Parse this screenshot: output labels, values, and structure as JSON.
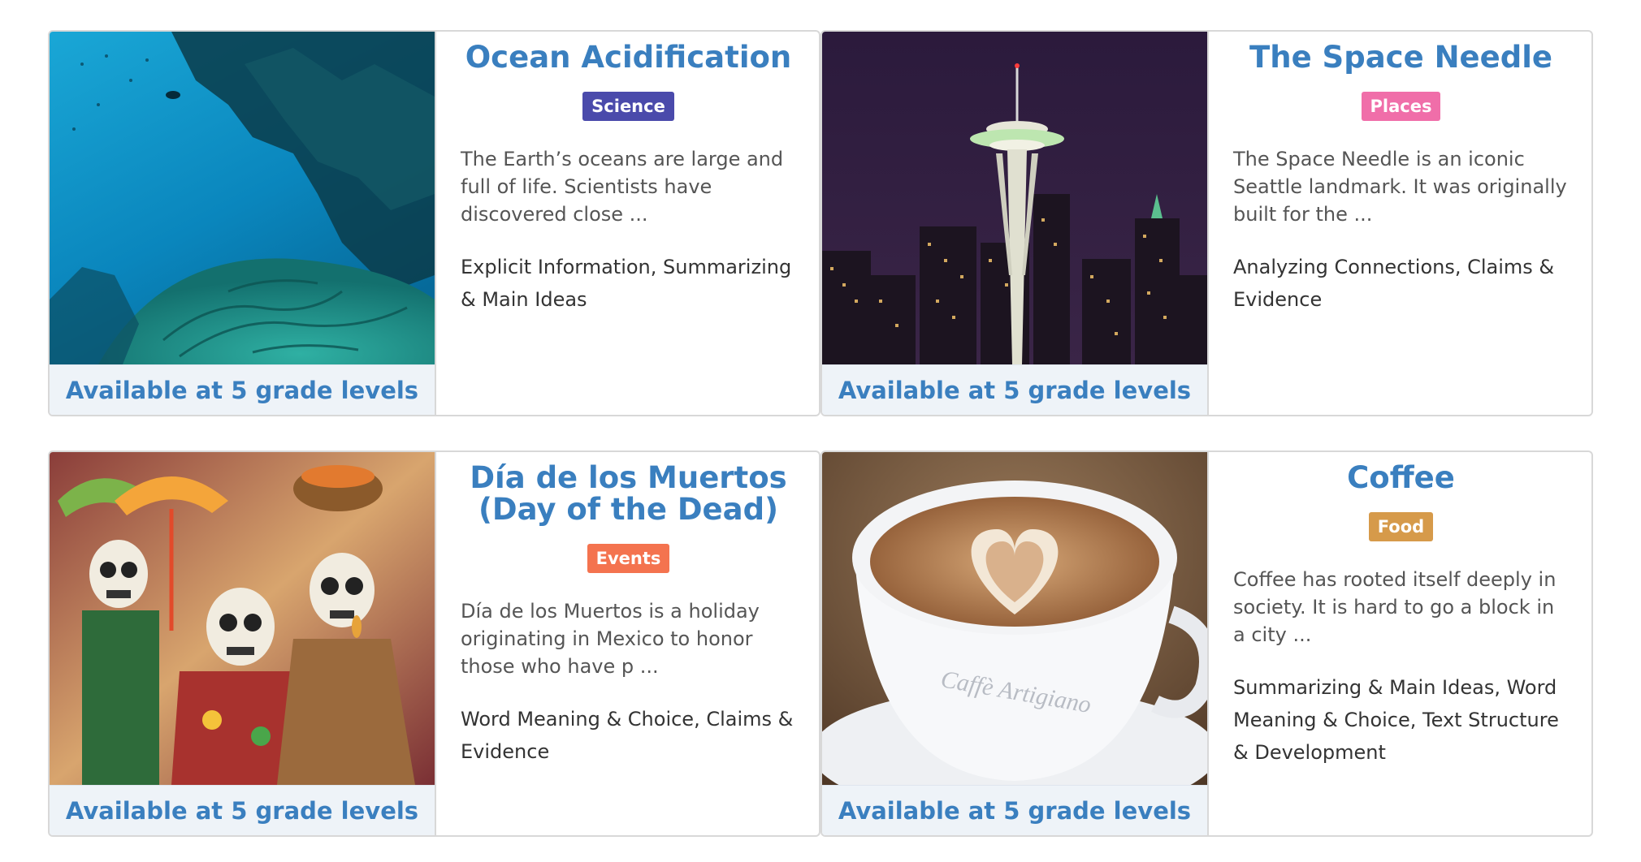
{
  "cards": [
    {
      "title": "Ocean Acidification",
      "tag": "Science",
      "tag_color": "#4a4aab",
      "description": "The Earth’s oceans are large and full of life. Scientists have discovered close ...",
      "skills": "Explicit Information, Summarizing & Main Ideas",
      "availability": "Available at 5 grade levels",
      "image": "coral-reef-photo"
    },
    {
      "title": "The Space Needle",
      "tag": "Places",
      "tag_color": "#f06ea9",
      "description": "The Space Needle is an iconic Seattle landmark. It was originally built for the ...",
      "skills": "Analyzing Connections, Claims & Evidence",
      "availability": "Available at 5 grade levels",
      "image": "seattle-skyline-photo"
    },
    {
      "title": "Día de los Muertos (Day of the Dead)",
      "tag": "Events",
      "tag_color": "#f4734f",
      "description": "Día de los Muertos is a holiday originating in Mexico to honor those who have p ...",
      "skills": "Word Meaning & Choice, Claims & Evidence",
      "availability": "Available at 5 grade levels",
      "image": "skeleton-figurines-photo"
    },
    {
      "title": "Coffee",
      "tag": "Food",
      "tag_color": "#d69a4a",
      "description": "Coffee has rooted itself deeply in society. It is hard to go a block in a city ...",
      "skills": "Summarizing & Main Ideas, Word Meaning & Choice, Text Structure & Development",
      "availability": "Available at 5 grade levels",
      "image": "latte-art-photo",
      "cup_print": "Caffè Artigiano"
    }
  ]
}
